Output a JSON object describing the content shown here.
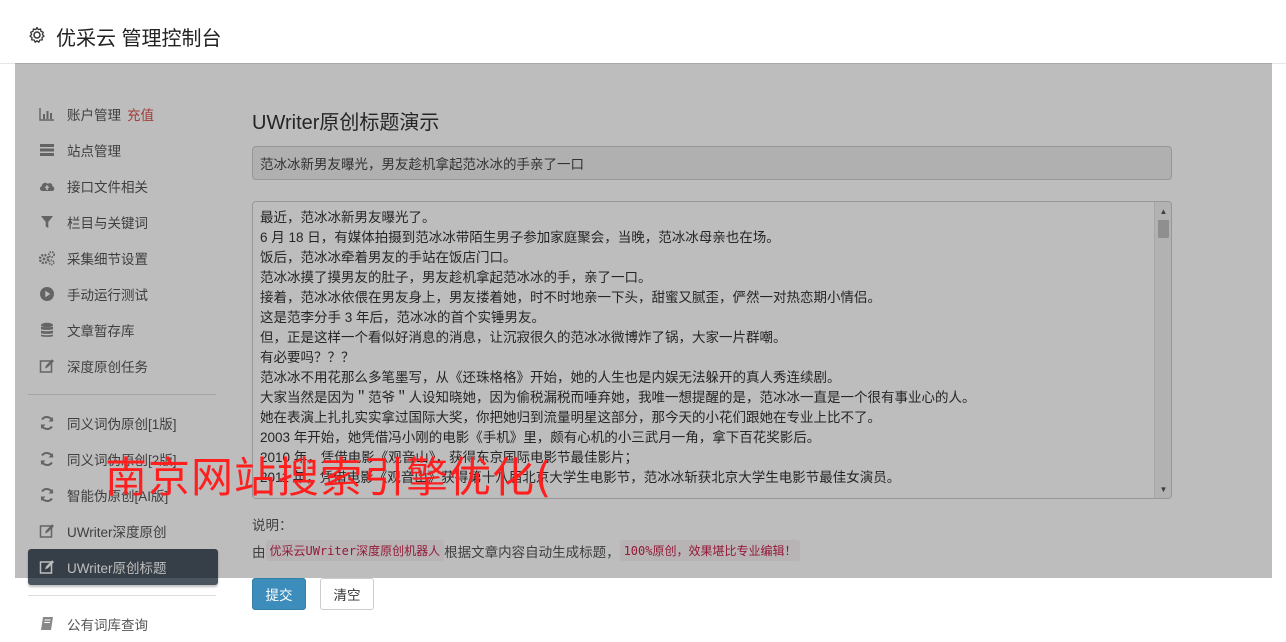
{
  "header": {
    "title": "优采云 管理控制台",
    "icon": "gear-icon"
  },
  "sidebar": {
    "items": [
      {
        "label": "账户管理",
        "badge": "充值",
        "icon": "bar-chart-icon"
      },
      {
        "label": "站点管理",
        "icon": "server-list-icon"
      },
      {
        "label": "接口文件相关",
        "icon": "cloud-upload-icon"
      },
      {
        "label": "栏目与关键词",
        "icon": "filter-icon"
      },
      {
        "label": "采集细节设置",
        "icon": "gears-icon"
      },
      {
        "label": "手动运行测试",
        "icon": "play-circle-icon"
      },
      {
        "label": "文章暂存库",
        "icon": "database-icon"
      },
      {
        "label": "深度原创任务",
        "icon": "edit-icon"
      },
      {
        "label": "同义词伪原创[1版]",
        "icon": "refresh-icon"
      },
      {
        "label": "同义词伪原创[2版]",
        "icon": "refresh-icon"
      },
      {
        "label": "智能伪原创[AI版]",
        "icon": "refresh-icon"
      },
      {
        "label": "UWriter深度原创",
        "icon": "edit-icon"
      },
      {
        "label": "UWriter原创标题",
        "icon": "edit-icon",
        "active": true
      },
      {
        "label": "公有词库查询",
        "icon": "book-icon"
      }
    ]
  },
  "main": {
    "page_title": "UWriter原创标题演示",
    "title_value": "范冰冰新男友曝光，男友趁机拿起范冰冰的手亲了一口",
    "content_lines": [
      "最近，范冰冰新男友曝光了。",
      "6 月 18 日，有媒体拍摄到范冰冰带陌生男子参加家庭聚会，当晚，范冰冰母亲也在场。",
      "饭后，范冰冰牵着男友的手站在饭店门口。",
      "范冰冰摸了摸男友的肚子，男友趁机拿起范冰冰的手，亲了一口。",
      "接着，范冰冰依偎在男友身上，男友搂着她，时不时地亲一下头，甜蜜又腻歪，俨然一对热恋期小情侣。",
      "这是范李分手 3 年后，范冰冰的首个实锤男友。",
      "但，正是这样一个看似好消息的消息，让沉寂很久的范冰冰微博炸了锅，大家一片群嘲。",
      "有必要吗？？？",
      "范冰冰不用花那么多笔墨写，从《还珠格格》开始，她的人生也是内娱无法躲开的真人秀连续剧。",
      "大家当然是因为＂范爷＂人设知晓她，因为偷税漏税而唾弃她，我唯一想提醒的是，范冰冰一直是一个很有事业心的人。",
      "她在表演上扎扎实实拿过国际大奖，你把她归到流量明星这部分，那今天的小花们跟她在专业上比不了。",
      "2003 年开始，她凭借冯小刚的电影《手机》里，颇有心机的小三武月一角，拿下百花奖影后。",
      "2010 年，凭借电影《观音山》，获得东京国际电影节最佳影片；",
      "2011 年，凭借电影《观音山》获得第十八届北京大学生电影节，范冰冰斩获北京大学生电影节最佳女演员。"
    ],
    "note_label": "说明：",
    "note_prefix": "由",
    "note_code1": "优采云UWriter深度原创机器人",
    "note_middle": "根据文章内容自动生成标题，",
    "note_code2": "100%原创，效果堪比专业编辑！",
    "submit_label": "提交",
    "clear_label": "清空"
  },
  "overlay": {
    "text": "南京网站搜索引擎优化("
  },
  "colors": {
    "accent": "#3c8dbc",
    "badge": "#d9534f",
    "active_nav": "#4a5560",
    "overlay_text": "#ff1f1f"
  }
}
